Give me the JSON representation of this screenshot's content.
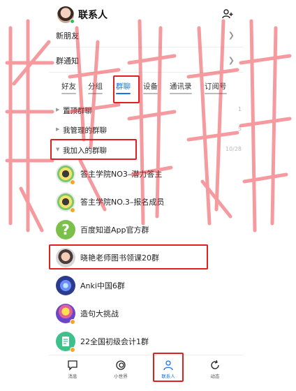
{
  "header": {
    "title": "联系人",
    "add_icon": "add-friend-icon"
  },
  "rows": [
    {
      "label": "新朋友"
    },
    {
      "label": "群通知"
    }
  ],
  "tabs": [
    "好友",
    "分组",
    "群聊",
    "设备",
    "通讯录",
    "订阅号"
  ],
  "active_tab": "群聊",
  "sections": [
    {
      "name": "置顶群聊",
      "count": "1"
    },
    {
      "name": "我管理的群聊",
      "count": "5"
    },
    {
      "name": "我加入的群聊",
      "count": "10/28"
    }
  ],
  "groups": [
    {
      "name": "答主学院NO3–潜力答主"
    },
    {
      "name": "答主学院NO.3–报名成员"
    },
    {
      "name": "百度知道App官方群"
    },
    {
      "name": "晓艳老师图书领课20群"
    },
    {
      "name": "Anki中国6群"
    },
    {
      "name": "造句大挑战"
    },
    {
      "name": "22全国初级会计1群"
    }
  ],
  "nav": [
    {
      "label": "消息"
    },
    {
      "label": "小世界"
    },
    {
      "label": "联系人"
    },
    {
      "label": "动态"
    }
  ],
  "colors": {
    "accent": "#1a73e8",
    "highlight": "#e02020",
    "watermark": "#e8202a"
  }
}
